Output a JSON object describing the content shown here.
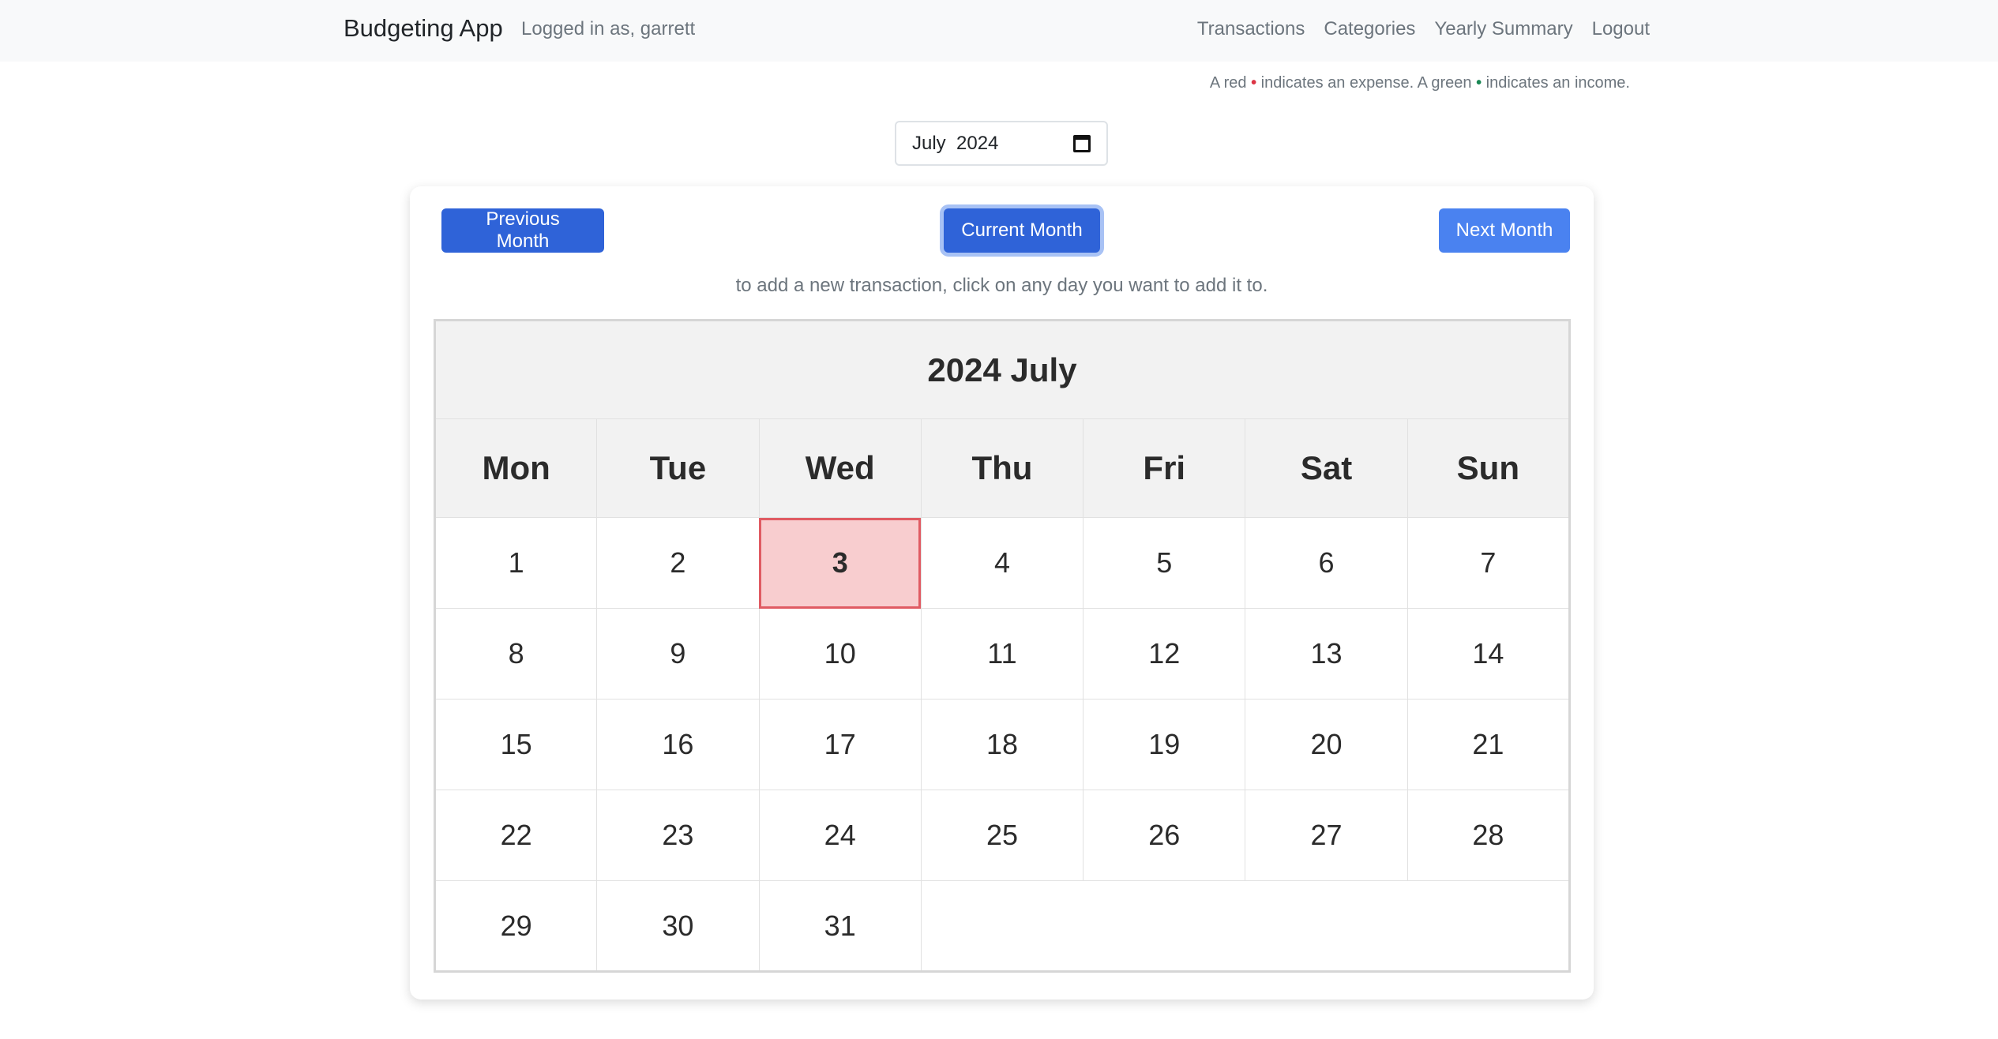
{
  "navbar": {
    "brand": "Budgeting App",
    "logged_in": "Logged in as, garrett",
    "links": [
      "Transactions",
      "Categories",
      "Yearly Summary",
      "Logout"
    ]
  },
  "legend": {
    "part1": "A red ",
    "dot": "•",
    "part2": " indicates an expense. A green ",
    "part3": " indicates an income."
  },
  "month_picker": {
    "value": "July  2024"
  },
  "buttons": {
    "previous": "Previous Month",
    "current": "Current Month",
    "next": "Next Month"
  },
  "hint": "to add a new transaction, click on any day you want to add it to.",
  "calendar": {
    "title": "2024 July",
    "weekdays": [
      "Mon",
      "Tue",
      "Wed",
      "Thu",
      "Fri",
      "Sat",
      "Sun"
    ],
    "weeks": [
      [
        "1",
        "2",
        "3",
        "4",
        "5",
        "6",
        "7"
      ],
      [
        "8",
        "9",
        "10",
        "11",
        "12",
        "13",
        "14"
      ],
      [
        "15",
        "16",
        "17",
        "18",
        "19",
        "20",
        "21"
      ],
      [
        "22",
        "23",
        "24",
        "25",
        "26",
        "27",
        "28"
      ],
      [
        "29",
        "30",
        "31"
      ]
    ],
    "today": "3",
    "today_color": "#f8cdcf"
  }
}
